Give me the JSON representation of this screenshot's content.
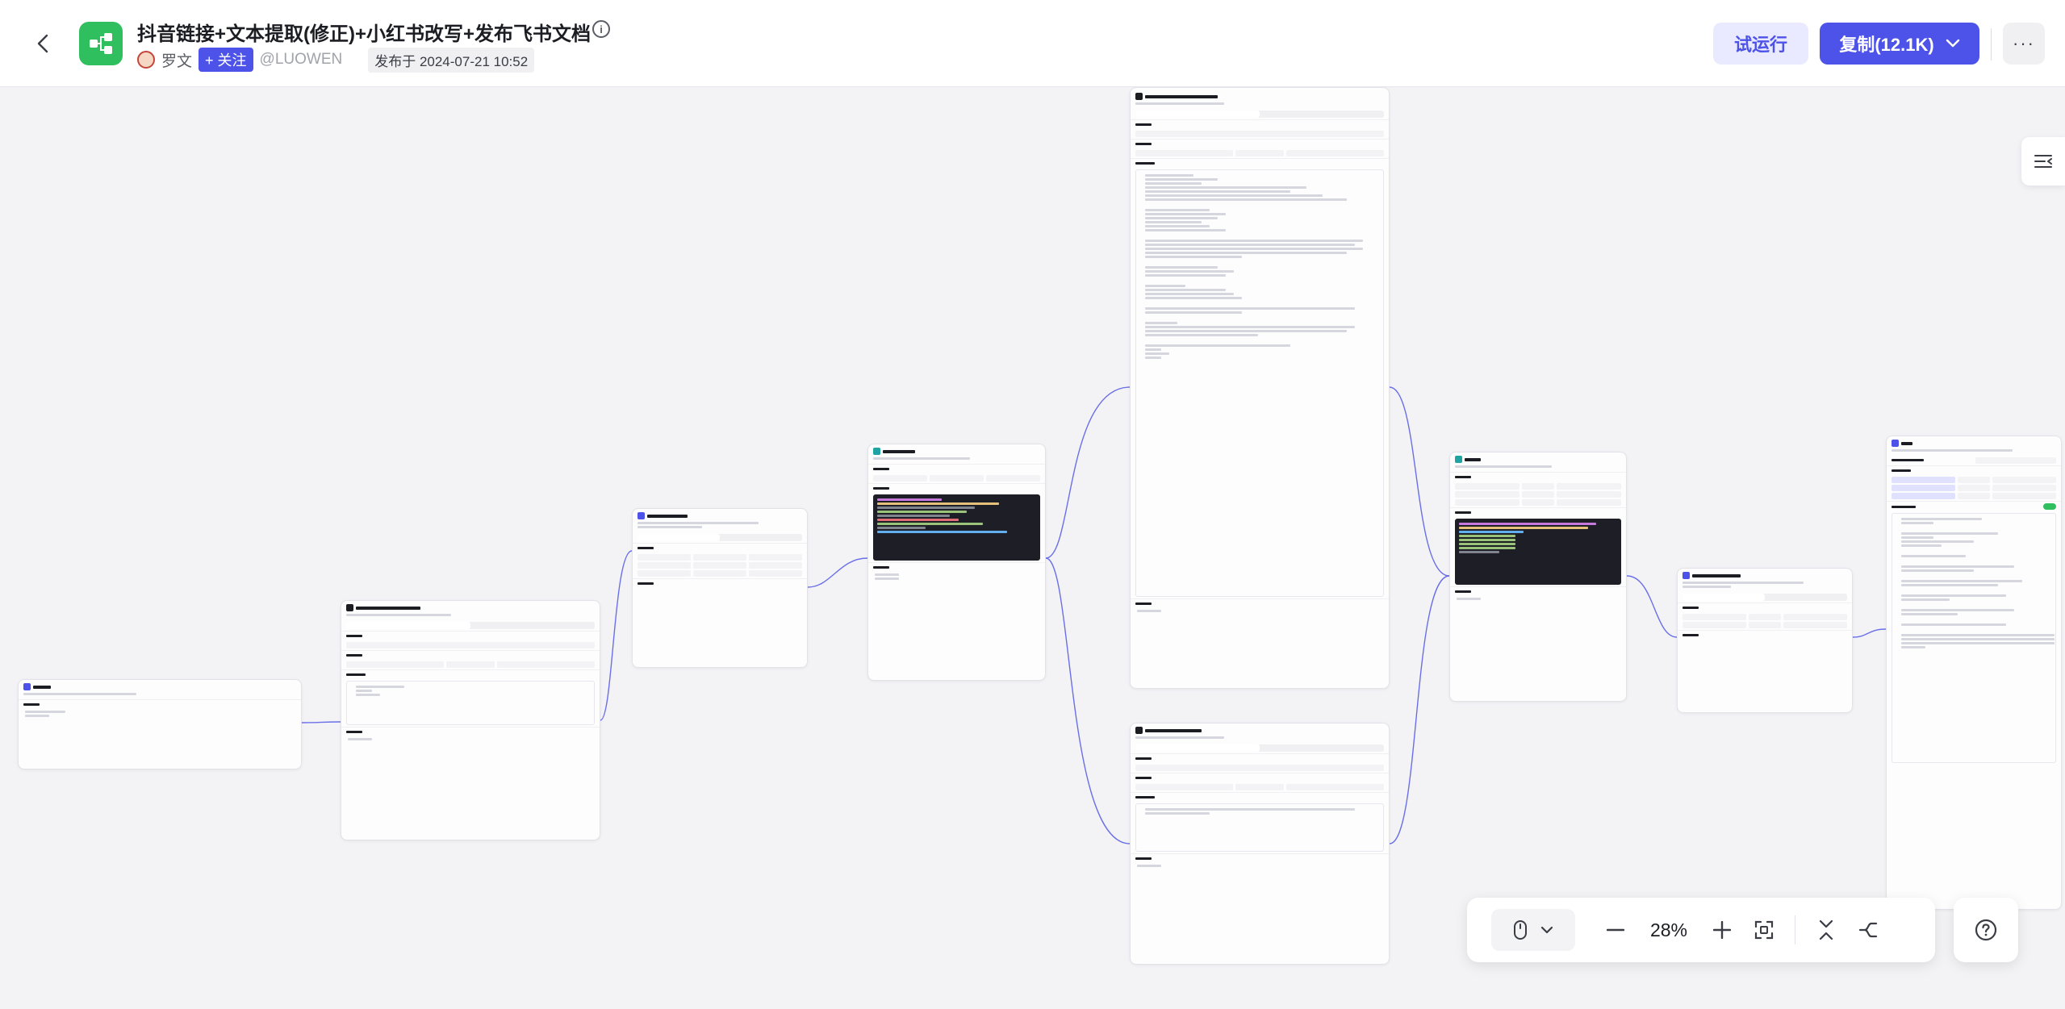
{
  "header": {
    "title": "抖音链接+文本提取(修正)+小红书改写+发布飞书文档",
    "author": "罗文",
    "follow_label": "+ 关注",
    "handle": "@LUOWEN",
    "published": "发布于 2024-07-21 10:52",
    "try_run_label": "试运行",
    "copy_label": "复制(12.1K)",
    "more_label": "···"
  },
  "toolbar": {
    "zoom": "28%"
  },
  "colors": {
    "accent": "#4d53e8",
    "app_logo": "#2fbf5f",
    "edge": "#6a6fe8"
  },
  "icons": {
    "back": "chevron-left-icon",
    "info": "info-icon",
    "copy_dropdown": "chevron-down-icon",
    "side_panel": "list-collapse-icon",
    "mouse": "mouse-icon",
    "zoom_out": "minus-icon",
    "zoom_in": "plus-icon",
    "fit": "fit-view-icon",
    "collapse": "collapse-icon",
    "layout": "auto-layout-icon",
    "help": "help-icon"
  }
}
